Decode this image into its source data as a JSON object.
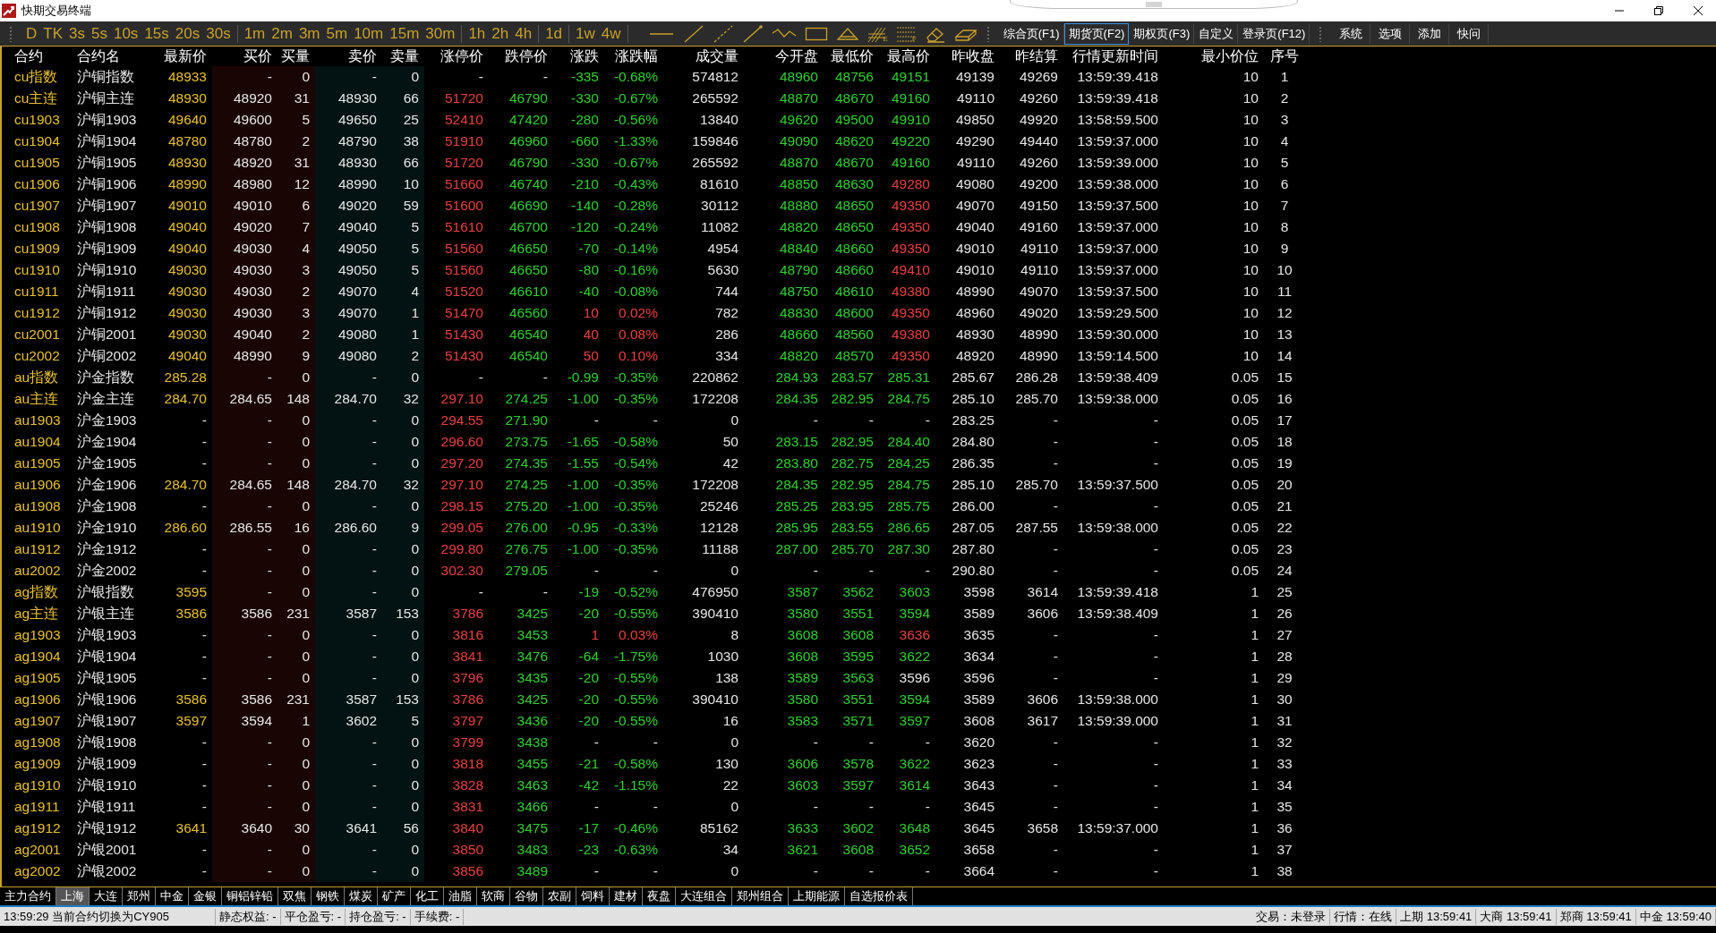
{
  "window": {
    "title": "快期交易终端"
  },
  "toolbar": {
    "period_groups": [
      [
        "D",
        "TK",
        "3s",
        "5s",
        "10s",
        "15s",
        "20s",
        "30s"
      ],
      [
        "1m",
        "2m",
        "3m",
        "5m",
        "10m",
        "15m",
        "30m"
      ],
      [
        "1h",
        "2h",
        "4h"
      ],
      [
        "1d"
      ],
      [
        "1w",
        "4w"
      ]
    ],
    "drawing_tools": [
      {
        "kind": "hline"
      },
      {
        "kind": "line"
      },
      {
        "kind": "dashed"
      },
      {
        "kind": "arrow"
      },
      {
        "kind": "zigzag"
      },
      {
        "kind": "rect"
      },
      {
        "kind": "triangle"
      },
      {
        "kind": "fan",
        "mark": "E"
      },
      {
        "kind": "levels",
        "mark": "F"
      },
      {
        "kind": "eraser"
      },
      {
        "kind": "clear"
      }
    ],
    "pages": [
      {
        "label": "综合页(F1)",
        "selected": false
      },
      {
        "label": "期货页(F2)",
        "selected": true
      },
      {
        "label": "期权页(F3)",
        "selected": false
      },
      {
        "label": "自定义",
        "selected": false
      },
      {
        "label": "登录页(F12)",
        "selected": false
      }
    ],
    "menu": [
      "系统",
      "选项",
      "添加",
      "快问"
    ]
  },
  "table": {
    "columns": [
      "合约",
      "合约名",
      "最新价",
      "买价",
      "买量",
      "卖价",
      "卖量",
      "涨停价",
      "跌停价",
      "涨跌",
      "涨跌幅",
      "成交量",
      "今开盘",
      "最低价",
      "最高价",
      "昨收盘",
      "昨结算",
      "行情更新时间",
      "最小价位",
      "序号"
    ],
    "rows": [
      [
        "cu指数",
        "沪铜指数",
        "48933",
        "-",
        "0",
        "-",
        "0",
        "-",
        "-",
        "-335",
        "-0.68%",
        "574812",
        "48960",
        "48756",
        "49151",
        "49139",
        "49269",
        "13:59:39.418",
        "10",
        "1"
      ],
      [
        "cu主连",
        "沪铜主连",
        "48930",
        "48920",
        "31",
        "48930",
        "66",
        "51720",
        "46790",
        "-330",
        "-0.67%",
        "265592",
        "48870",
        "48670",
        "49160",
        "49110",
        "49260",
        "13:59:39.418",
        "10",
        "2"
      ],
      [
        "cu1903",
        "沪铜1903",
        "49640",
        "49600",
        "5",
        "49650",
        "25",
        "52410",
        "47420",
        "-280",
        "-0.56%",
        "13840",
        "49620",
        "49500",
        "49910",
        "49850",
        "49920",
        "13:58:59.500",
        "10",
        "3"
      ],
      [
        "cu1904",
        "沪铜1904",
        "48780",
        "48780",
        "2",
        "48790",
        "38",
        "51910",
        "46960",
        "-660",
        "-1.33%",
        "159846",
        "49090",
        "48620",
        "49220",
        "49290",
        "49440",
        "13:59:37.000",
        "10",
        "4"
      ],
      [
        "cu1905",
        "沪铜1905",
        "48930",
        "48920",
        "31",
        "48930",
        "66",
        "51720",
        "46790",
        "-330",
        "-0.67%",
        "265592",
        "48870",
        "48670",
        "49160",
        "49110",
        "49260",
        "13:59:39.000",
        "10",
        "5"
      ],
      [
        "cu1906",
        "沪铜1906",
        "48990",
        "48980",
        "12",
        "48990",
        "10",
        "51660",
        "46740",
        "-210",
        "-0.43%",
        "81610",
        "48850",
        "48630",
        "49280",
        "49080",
        "49200",
        "13:59:38.000",
        "10",
        "6"
      ],
      [
        "cu1907",
        "沪铜1907",
        "49010",
        "49010",
        "6",
        "49020",
        "59",
        "51600",
        "46690",
        "-140",
        "-0.28%",
        "30112",
        "48880",
        "48650",
        "49350",
        "49070",
        "49150",
        "13:59:37.500",
        "10",
        "7"
      ],
      [
        "cu1908",
        "沪铜1908",
        "49040",
        "49020",
        "7",
        "49040",
        "5",
        "51610",
        "46700",
        "-120",
        "-0.24%",
        "11082",
        "48820",
        "48650",
        "49350",
        "49040",
        "49160",
        "13:59:37.000",
        "10",
        "8"
      ],
      [
        "cu1909",
        "沪铜1909",
        "49040",
        "49030",
        "4",
        "49050",
        "5",
        "51560",
        "46650",
        "-70",
        "-0.14%",
        "4954",
        "48840",
        "48660",
        "49350",
        "49010",
        "49110",
        "13:59:37.000",
        "10",
        "9"
      ],
      [
        "cu1910",
        "沪铜1910",
        "49030",
        "49030",
        "3",
        "49050",
        "5",
        "51560",
        "46650",
        "-80",
        "-0.16%",
        "5630",
        "48790",
        "48660",
        "49410",
        "49010",
        "49110",
        "13:59:37.000",
        "10",
        "10"
      ],
      [
        "cu1911",
        "沪铜1911",
        "49030",
        "49030",
        "2",
        "49070",
        "4",
        "51520",
        "46610",
        "-40",
        "-0.08%",
        "744",
        "48750",
        "48610",
        "49380",
        "48990",
        "49070",
        "13:59:37.500",
        "10",
        "11"
      ],
      [
        "cu1912",
        "沪铜1912",
        "49030",
        "49030",
        "3",
        "49070",
        "1",
        "51470",
        "46560",
        "10",
        "0.02%",
        "782",
        "48830",
        "48600",
        "49350",
        "48960",
        "49020",
        "13:59:29.500",
        "10",
        "12"
      ],
      [
        "cu2001",
        "沪铜2001",
        "49030",
        "49040",
        "2",
        "49080",
        "1",
        "51430",
        "46540",
        "40",
        "0.08%",
        "286",
        "48660",
        "48560",
        "49380",
        "48930",
        "48990",
        "13:59:30.000",
        "10",
        "13"
      ],
      [
        "cu2002",
        "沪铜2002",
        "49040",
        "48990",
        "9",
        "49080",
        "2",
        "51430",
        "46540",
        "50",
        "0.10%",
        "334",
        "48820",
        "48570",
        "49350",
        "48920",
        "48990",
        "13:59:14.500",
        "10",
        "14"
      ],
      [
        "au指数",
        "沪金指数",
        "285.28",
        "-",
        "0",
        "-",
        "0",
        "-",
        "-",
        "-0.99",
        "-0.35%",
        "220862",
        "284.93",
        "283.57",
        "285.31",
        "285.67",
        "286.28",
        "13:59:38.409",
        "0.05",
        "15"
      ],
      [
        "au主连",
        "沪金主连",
        "284.70",
        "284.65",
        "148",
        "284.70",
        "32",
        "297.10",
        "274.25",
        "-1.00",
        "-0.35%",
        "172208",
        "284.35",
        "282.95",
        "284.75",
        "285.10",
        "285.70",
        "13:59:38.000",
        "0.05",
        "16"
      ],
      [
        "au1903",
        "沪金1903",
        "-",
        "-",
        "0",
        "-",
        "0",
        "294.55",
        "271.90",
        "-",
        "-",
        "0",
        "-",
        "-",
        "-",
        "283.25",
        "-",
        "-",
        "0.05",
        "17"
      ],
      [
        "au1904",
        "沪金1904",
        "-",
        "-",
        "0",
        "-",
        "0",
        "296.60",
        "273.75",
        "-1.65",
        "-0.58%",
        "50",
        "283.15",
        "282.95",
        "284.40",
        "284.80",
        "-",
        "-",
        "0.05",
        "18"
      ],
      [
        "au1905",
        "沪金1905",
        "-",
        "-",
        "0",
        "-",
        "0",
        "297.20",
        "274.35",
        "-1.55",
        "-0.54%",
        "42",
        "283.80",
        "282.75",
        "284.25",
        "286.35",
        "-",
        "-",
        "0.05",
        "19"
      ],
      [
        "au1906",
        "沪金1906",
        "284.70",
        "284.65",
        "148",
        "284.70",
        "32",
        "297.10",
        "274.25",
        "-1.00",
        "-0.35%",
        "172208",
        "284.35",
        "282.95",
        "284.75",
        "285.10",
        "285.70",
        "13:59:37.500",
        "0.05",
        "20"
      ],
      [
        "au1908",
        "沪金1908",
        "-",
        "-",
        "0",
        "-",
        "0",
        "298.15",
        "275.20",
        "-1.00",
        "-0.35%",
        "25246",
        "285.25",
        "283.95",
        "285.75",
        "286.00",
        "-",
        "-",
        "0.05",
        "21"
      ],
      [
        "au1910",
        "沪金1910",
        "286.60",
        "286.55",
        "16",
        "286.60",
        "9",
        "299.05",
        "276.00",
        "-0.95",
        "-0.33%",
        "12128",
        "285.95",
        "283.55",
        "286.65",
        "287.05",
        "287.55",
        "13:59:38.000",
        "0.05",
        "22"
      ],
      [
        "au1912",
        "沪金1912",
        "-",
        "-",
        "0",
        "-",
        "0",
        "299.80",
        "276.75",
        "-1.00",
        "-0.35%",
        "11188",
        "287.00",
        "285.70",
        "287.30",
        "287.80",
        "-",
        "-",
        "0.05",
        "23"
      ],
      [
        "au2002",
        "沪金2002",
        "-",
        "-",
        "0",
        "-",
        "0",
        "302.30",
        "279.05",
        "-",
        "-",
        "0",
        "-",
        "-",
        "-",
        "290.80",
        "-",
        "-",
        "0.05",
        "24"
      ],
      [
        "ag指数",
        "沪银指数",
        "3595",
        "-",
        "0",
        "-",
        "0",
        "-",
        "-",
        "-19",
        "-0.52%",
        "476950",
        "3587",
        "3562",
        "3603",
        "3598",
        "3614",
        "13:59:39.418",
        "1",
        "25"
      ],
      [
        "ag主连",
        "沪银主连",
        "3586",
        "3586",
        "231",
        "3587",
        "153",
        "3786",
        "3425",
        "-20",
        "-0.55%",
        "390410",
        "3580",
        "3551",
        "3594",
        "3589",
        "3606",
        "13:59:38.409",
        "1",
        "26"
      ],
      [
        "ag1903",
        "沪银1903",
        "-",
        "-",
        "0",
        "-",
        "0",
        "3816",
        "3453",
        "1",
        "0.03%",
        "8",
        "3608",
        "3608",
        "3636",
        "3635",
        "-",
        "-",
        "1",
        "27"
      ],
      [
        "ag1904",
        "沪银1904",
        "-",
        "-",
        "0",
        "-",
        "0",
        "3841",
        "3476",
        "-64",
        "-1.75%",
        "1030",
        "3608",
        "3595",
        "3622",
        "3634",
        "-",
        "-",
        "1",
        "28"
      ],
      [
        "ag1905",
        "沪银1905",
        "-",
        "-",
        "0",
        "-",
        "0",
        "3796",
        "3435",
        "-20",
        "-0.55%",
        "138",
        "3589",
        "3563",
        "3596",
        "3596",
        "-",
        "-",
        "1",
        "29"
      ],
      [
        "ag1906",
        "沪银1906",
        "3586",
        "3586",
        "231",
        "3587",
        "153",
        "3786",
        "3425",
        "-20",
        "-0.55%",
        "390410",
        "3580",
        "3551",
        "3594",
        "3589",
        "3606",
        "13:59:38.000",
        "1",
        "30"
      ],
      [
        "ag1907",
        "沪银1907",
        "3597",
        "3594",
        "1",
        "3602",
        "5",
        "3797",
        "3436",
        "-20",
        "-0.55%",
        "16",
        "3583",
        "3571",
        "3597",
        "3608",
        "3617",
        "13:59:39.000",
        "1",
        "31"
      ],
      [
        "ag1908",
        "沪银1908",
        "-",
        "-",
        "0",
        "-",
        "0",
        "3799",
        "3438",
        "-",
        "-",
        "0",
        "-",
        "-",
        "-",
        "3620",
        "-",
        "-",
        "1",
        "32"
      ],
      [
        "ag1909",
        "沪银1909",
        "-",
        "-",
        "0",
        "-",
        "0",
        "3818",
        "3455",
        "-21",
        "-0.58%",
        "130",
        "3606",
        "3578",
        "3622",
        "3623",
        "-",
        "-",
        "1",
        "33"
      ],
      [
        "ag1910",
        "沪银1910",
        "-",
        "-",
        "0",
        "-",
        "0",
        "3828",
        "3463",
        "-42",
        "-1.15%",
        "22",
        "3603",
        "3597",
        "3614",
        "3643",
        "-",
        "-",
        "1",
        "34"
      ],
      [
        "ag1911",
        "沪银1911",
        "-",
        "-",
        "0",
        "-",
        "0",
        "3831",
        "3466",
        "-",
        "-",
        "0",
        "-",
        "-",
        "-",
        "3645",
        "-",
        "-",
        "1",
        "35"
      ],
      [
        "ag1912",
        "沪银1912",
        "3641",
        "3640",
        "30",
        "3641",
        "56",
        "3840",
        "3475",
        "-17",
        "-0.46%",
        "85162",
        "3633",
        "3602",
        "3648",
        "3645",
        "3658",
        "13:59:37.000",
        "1",
        "36"
      ],
      [
        "ag2001",
        "沪银2001",
        "-",
        "-",
        "0",
        "-",
        "0",
        "3850",
        "3483",
        "-23",
        "-0.63%",
        "34",
        "3621",
        "3608",
        "3652",
        "3658",
        "-",
        "-",
        "1",
        "37"
      ],
      [
        "ag2002",
        "沪银2002",
        "-",
        "-",
        "0",
        "-",
        "0",
        "3856",
        "3489",
        "-",
        "-",
        "0",
        "-",
        "-",
        "-",
        "3664",
        "-",
        "-",
        "1",
        "38"
      ]
    ]
  },
  "exchange_tabs": [
    {
      "label": "主力合约",
      "selected": false
    },
    {
      "label": "上海",
      "selected": true
    },
    {
      "label": "大连",
      "selected": false
    },
    {
      "label": "郑州",
      "selected": false
    },
    {
      "label": "中金",
      "selected": false
    },
    {
      "label": "金银",
      "selected": false
    },
    {
      "label": "铜铝锌铅",
      "selected": false
    },
    {
      "label": "双焦",
      "selected": false
    },
    {
      "label": "钢铁",
      "selected": false
    },
    {
      "label": "煤炭",
      "selected": false
    },
    {
      "label": "矿产",
      "selected": false
    },
    {
      "label": "化工",
      "selected": false
    },
    {
      "label": "油脂",
      "selected": false
    },
    {
      "label": "软商",
      "selected": false
    },
    {
      "label": "谷物",
      "selected": false
    },
    {
      "label": "农副",
      "selected": false
    },
    {
      "label": "饲料",
      "selected": false
    },
    {
      "label": "建材",
      "selected": false
    },
    {
      "label": "夜盘",
      "selected": false
    },
    {
      "label": "大连组合",
      "selected": false
    },
    {
      "label": "郑州组合",
      "selected": false
    },
    {
      "label": "上期能源",
      "selected": false
    },
    {
      "label": "自选报价表",
      "selected": false
    }
  ],
  "status_bar": {
    "message": "13:59:29 当前合约切换为CY905",
    "left": [
      "静态权益: -",
      "平仓盈亏: -",
      "持仓盈亏: -",
      "手续费: -"
    ],
    "right": [
      "交易：未登录",
      "行情：在线",
      "上期 13:59:41",
      "大商 13:59:41",
      "郑商 13:59:41",
      "中金 13:59:40"
    ]
  }
}
